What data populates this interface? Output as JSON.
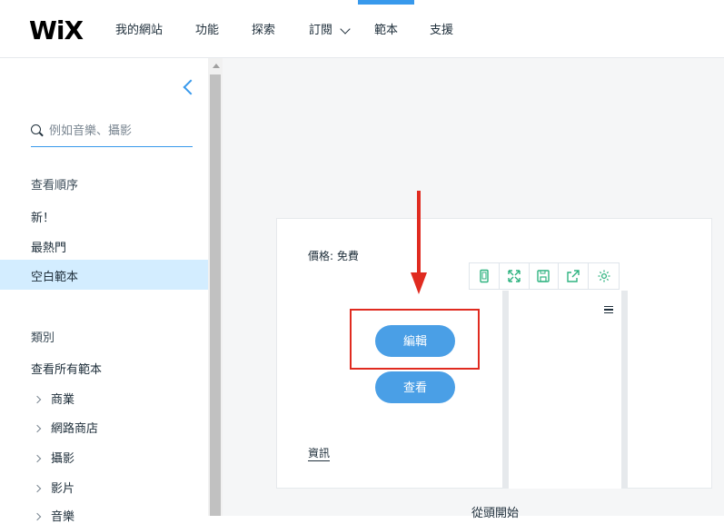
{
  "header": {
    "logo": "WiX",
    "nav": [
      {
        "label": "我的網站"
      },
      {
        "label": "功能"
      },
      {
        "label": "探索"
      },
      {
        "label": "訂閱"
      },
      {
        "label": "範本"
      },
      {
        "label": "支援"
      }
    ],
    "active_nav": "範本"
  },
  "sidebar": {
    "search_placeholder": "例如音樂、攝影",
    "sort_heading": "查看順序",
    "sort_items": [
      {
        "label": "新！"
      },
      {
        "label": "最熱門"
      },
      {
        "label": "空白範本",
        "selected": true
      }
    ],
    "category_heading": "類別",
    "all_templates": "查看所有範本",
    "categories": [
      {
        "label": "商業"
      },
      {
        "label": "網路商店"
      },
      {
        "label": "攝影"
      },
      {
        "label": "影片"
      },
      {
        "label": "音樂"
      }
    ]
  },
  "template_card": {
    "price": "價格: 免費",
    "edit_button": "編輯",
    "view_button": "查看",
    "info_link": "資訊"
  },
  "footer_text": "從頭開始",
  "colors": {
    "accent": "#3899ec",
    "button": "#4a9fe6",
    "annotation_red": "#e02b20",
    "toolbar_icon": "#2fb380",
    "selected_bg": "#d3edff"
  }
}
